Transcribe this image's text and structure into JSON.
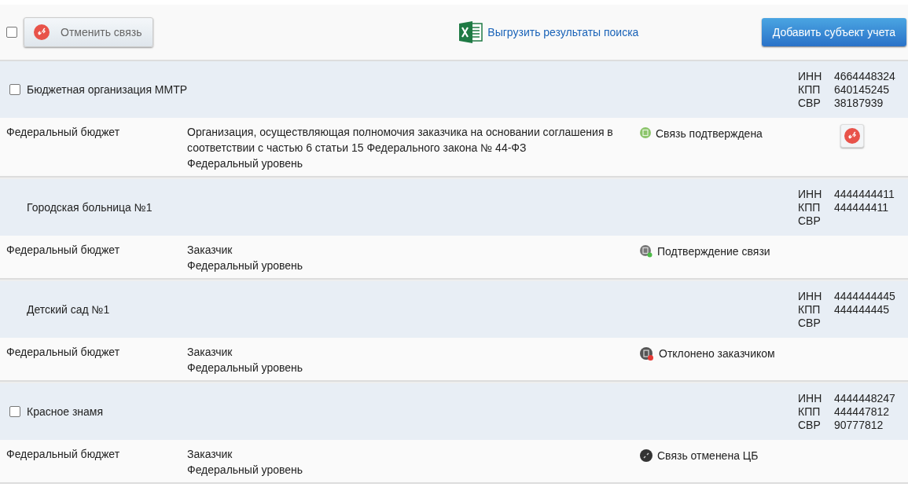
{
  "toolbar": {
    "select_all": {
      "checked": false
    },
    "unlink_button": "Отменить связь",
    "export_link": "Выгрузить результаты поиска",
    "add_button": "Добавить субъект учета"
  },
  "entries": [
    {
      "name": "Бюджетная организация ММТР",
      "checked": false,
      "ids": [
        {
          "label": "ИНН",
          "value": "4664448324"
        },
        {
          "label": "КПП",
          "value": "640145245"
        },
        {
          "label": "СВР",
          "value": "38187939"
        }
      ],
      "budget": "Федеральный бюджет",
      "role_lines": [
        "Организация, осуществляющая полномочия заказчика на основании соглашения в соответствии с частью 6 статьи 15 Федерального закона № 44-ФЗ",
        "Федеральный уровень"
      ],
      "status": {
        "kind": "confirmed",
        "text": "Связь подтверждена"
      },
      "has_unlink": true
    },
    {
      "name": "Городская больница №1",
      "ids": [
        {
          "label": "ИНН",
          "value": "4444444411"
        },
        {
          "label": "КПП",
          "value": "444444411"
        },
        {
          "label": "СВР"
        }
      ],
      "budget": "Федеральный бюджет",
      "role_lines": [
        "Заказчик",
        "Федеральный уровень"
      ],
      "status": {
        "kind": "pending",
        "text": "Подтверждение связи"
      },
      "has_unlink": false
    },
    {
      "name": "Детский сад №1",
      "ids": [
        {
          "label": "ИНН",
          "value": "4444444445"
        },
        {
          "label": "КПП",
          "value": "444444445"
        },
        {
          "label": "СВР"
        }
      ],
      "budget": "Федеральный бюджет",
      "role_lines": [
        "Заказчик",
        "Федеральный уровень"
      ],
      "status": {
        "kind": "rejected",
        "text": "Отклонено заказчиком"
      },
      "has_unlink": false
    },
    {
      "name": "Красное знамя",
      "checked": false,
      "ids": [
        {
          "label": "ИНН",
          "value": "4444448247"
        },
        {
          "label": "КПП",
          "value": "444447812"
        },
        {
          "label": "СВР",
          "value": "90777812"
        }
      ],
      "budget": "Федеральный бюджет",
      "role_lines": [
        "Заказчик",
        "Федеральный уровень"
      ],
      "status": {
        "kind": "cancelled",
        "text": "Связь отменена ЦБ"
      },
      "has_unlink": false
    }
  ]
}
